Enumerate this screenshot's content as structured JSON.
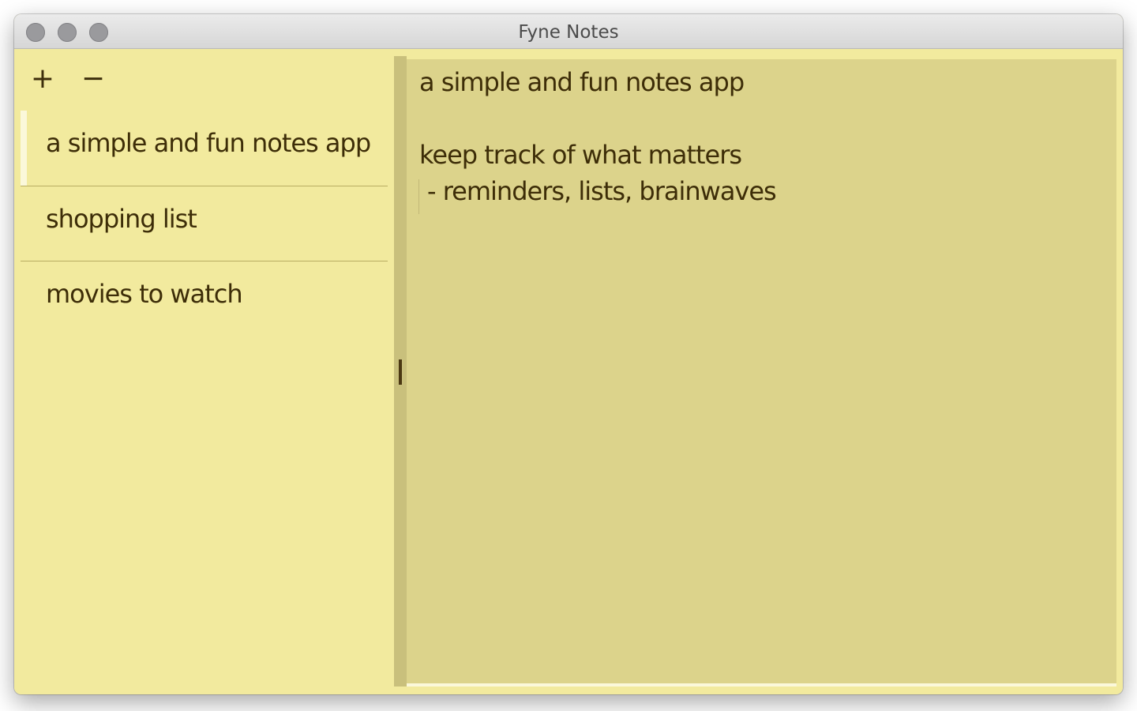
{
  "window": {
    "title": "Fyne Notes"
  },
  "toolbar": {
    "add_label": "+",
    "remove_label": "−"
  },
  "notes": [
    {
      "label": "a simple and fun notes app",
      "selected": true
    },
    {
      "label": "shopping list",
      "selected": false
    },
    {
      "label": "movies to watch",
      "selected": false
    }
  ],
  "editor": {
    "lines": [
      "a simple and fun notes app",
      "",
      "keep track of what matters",
      "- reminders, lists, brainwaves"
    ]
  },
  "colors": {
    "background": "#f2ea9e",
    "editor_background": "#dcd38b",
    "text": "#3d2d08",
    "selection_bar": "#fbf8da",
    "divider": "#b9ae63"
  },
  "icons": {
    "close": "traffic-light-close-icon",
    "minimize": "traffic-light-minimize-icon",
    "zoom": "traffic-light-zoom-icon"
  }
}
